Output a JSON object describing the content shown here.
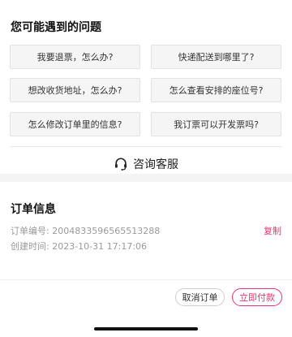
{
  "faq": {
    "title": "您可能遇到的问题",
    "questions": [
      "我要退票，怎么办?",
      "快递配送到哪里了?",
      "想改收货地址，怎么办?",
      "怎么查看安排的座位号?",
      "怎么修改订单里的信息?",
      "我订票可以开发票吗?"
    ],
    "customer_service_label": "咨询客服",
    "customer_service_icon": "headset-icon"
  },
  "order": {
    "title": "订单信息",
    "number_label": "订单编号:",
    "number_value": "2004833596565513288",
    "created_label": "创建时间:",
    "created_value": "2023-10-31 17:17:06",
    "copy_label": "复制"
  },
  "actions": {
    "cancel_label": "取消订单",
    "pay_label": "立即付款"
  },
  "colors": {
    "accent": "#e8336a"
  }
}
